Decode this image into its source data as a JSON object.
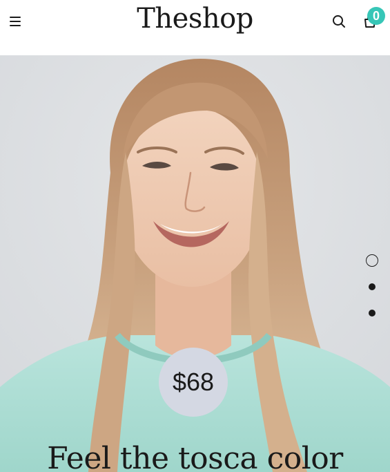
{
  "header": {
    "logo": "Theshop",
    "menu_icon": "hamburger-menu-icon",
    "search_icon": "search-icon",
    "cart_icon": "shopping-bag-icon",
    "cart_count": "0"
  },
  "hero": {
    "price": "$68",
    "title": "Feel the tosca color",
    "slides": [
      {
        "active": true
      },
      {
        "active": false
      },
      {
        "active": false
      }
    ]
  },
  "colors": {
    "accent": "#37c6b7",
    "price_badge": "#d4d8e3",
    "text": "#1a1a1a",
    "background": "#dfe2e5"
  }
}
